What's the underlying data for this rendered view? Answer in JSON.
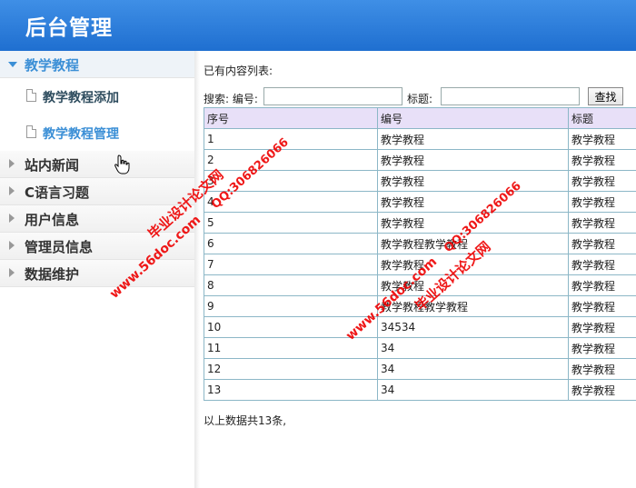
{
  "header": {
    "title": "后台管理"
  },
  "sidebar": {
    "groups": [
      {
        "label": "教学教程",
        "items": [
          {
            "label": "教学教程添加"
          },
          {
            "label": "教学教程管理"
          }
        ]
      },
      {
        "label": "站内新闻"
      },
      {
        "label": "C语言习题"
      },
      {
        "label": "用户信息"
      },
      {
        "label": "管理员信息"
      },
      {
        "label": "数据维护"
      }
    ]
  },
  "main": {
    "list_title": "已有内容列表:",
    "search": {
      "label1": "搜索: 编号:",
      "value1": "",
      "label2": "标题:",
      "value2": "",
      "button": "查找"
    },
    "table": {
      "headers": [
        "序号",
        "编号",
        "标题"
      ],
      "rows": [
        [
          "1",
          "教学教程",
          "教学教程"
        ],
        [
          "2",
          "教学教程",
          "教学教程"
        ],
        [
          "3",
          "教学教程",
          "教学教程"
        ],
        [
          "4",
          "教学教程",
          "教学教程"
        ],
        [
          "5",
          "教学教程",
          "教学教程"
        ],
        [
          "6",
          "教学教程教学教程",
          "教学教程"
        ],
        [
          "7",
          "教学教程",
          "教学教程"
        ],
        [
          "8",
          "教学教程",
          "教学教程"
        ],
        [
          "9",
          "教学教程教学教程",
          "教学教程"
        ],
        [
          "10",
          "34534",
          "教学教程"
        ],
        [
          "11",
          "34",
          "教学教程"
        ],
        [
          "12",
          "34",
          "教学教程"
        ],
        [
          "13",
          "34",
          "教学教程"
        ]
      ]
    },
    "summary": "以上数据共13条,"
  },
  "watermarks": {
    "site": "www.56doc.com",
    "name": "毕业设计论文网",
    "qq": "QQ:306826066"
  }
}
